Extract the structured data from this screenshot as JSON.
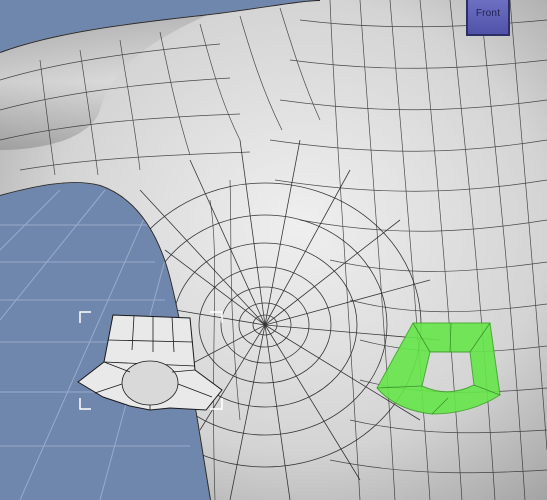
{
  "viewport": {
    "background_color": "#6f86ad",
    "grid_color": "#9fb0cd",
    "mesh_color": "#1a1a1a",
    "body_fill": "#cfcfcf",
    "selection_color": "#66e64a"
  },
  "viewcube": {
    "label": "Front",
    "face_color": "#5a5db5"
  },
  "objects": {
    "body_mesh": "torso-mesh",
    "detached_part": "patch-copy",
    "selected_faces": "selected-polygon-ring"
  }
}
